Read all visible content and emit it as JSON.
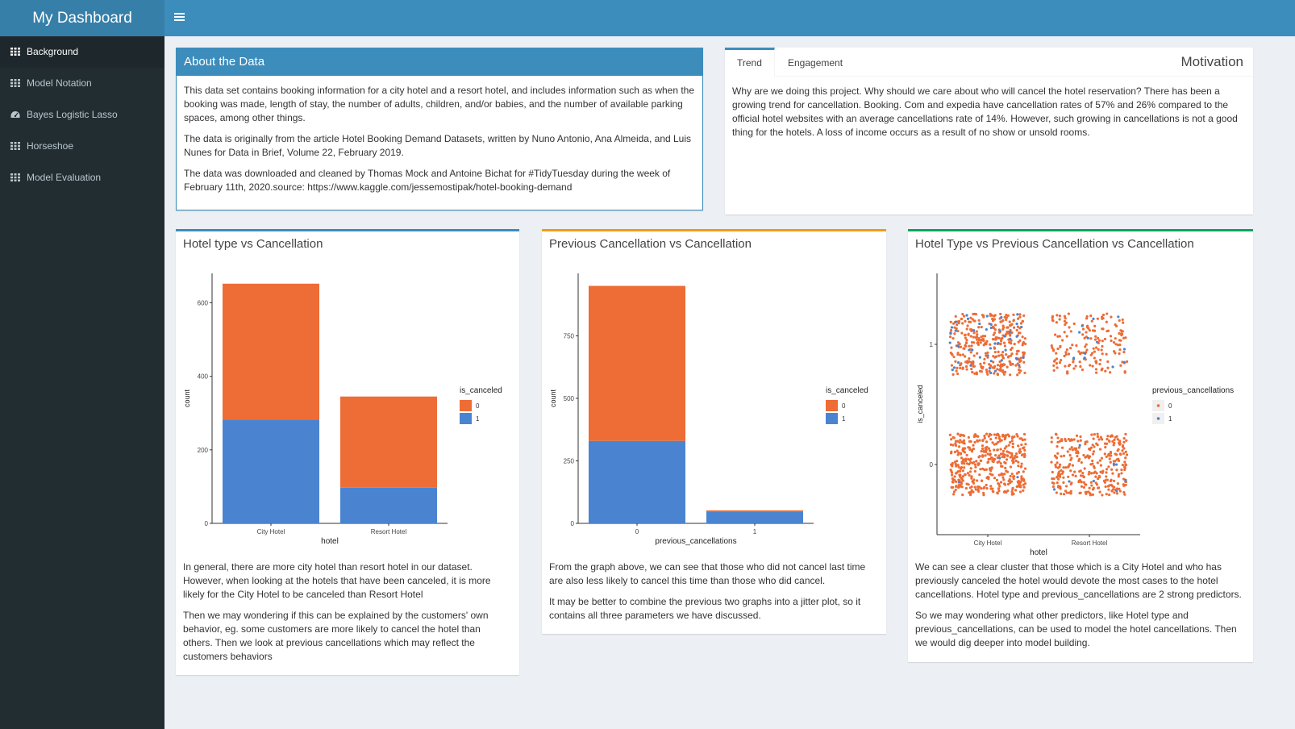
{
  "header": {
    "brand": "My Dashboard",
    "menu_icon": "hamburger-icon"
  },
  "sidebar": {
    "items": [
      {
        "label": "Background",
        "icon": "grid-icon",
        "active": true
      },
      {
        "label": "Model Notation",
        "icon": "grid-icon",
        "active": false
      },
      {
        "label": "Bayes Logistic Lasso",
        "icon": "dashboard-icon",
        "active": false
      },
      {
        "label": "Horseshoe",
        "icon": "grid-icon",
        "active": false
      },
      {
        "label": "Model Evaluation",
        "icon": "grid-icon",
        "active": false
      }
    ]
  },
  "about": {
    "title": "About the Data",
    "paragraphs": [
      "This data set contains booking information for a city hotel and a resort hotel, and includes information such as when the booking was made, length of stay, the number of adults, children, and/or babies, and the number of available parking spaces, among other things.",
      "The data is originally from the article Hotel Booking Demand Datasets, written by Nuno Antonio, Ana Almeida, and Luis Nunes for Data in Brief, Volume 22, February 2019.",
      "The data was downloaded and cleaned by Thomas Mock and Antoine Bichat for #TidyTuesday during the week of February 11th, 2020.source: https://www.kaggle.com/jessemostipak/hotel-booking-demand"
    ]
  },
  "motivation": {
    "title": "Motivation",
    "tabs": [
      "Trend",
      "Engagement"
    ],
    "text": "Why are we doing this project. Why should we care about who will cancel the hotel reservation? There has been a growing trend for cancellation. Booking. Com and expedia have cancellation rates of 57% and 26% compared to the official hotel websites with an average cancellations rate of 14%. However, such growing in cancellations is not a good thing for the hotels. A loss of income occurs as a result of no show or unsold rooms."
  },
  "colors": {
    "orange": "#ee6c35",
    "blue": "#4a84d0",
    "accent": "#3c8dbc"
  },
  "panels": [
    {
      "title": "Hotel type vs Cancellation",
      "paragraphs": [
        "In general, there are more city hotel than resort hotel in our dataset. However, when looking at the hotels that have been canceled, it is more likely for the City Hotel to be canceled than Resort Hotel",
        "Then we may wondering if this can be explained by the customers' own behavior, eg. some customers are more likely to cancel the hotel than others. Then we look at previous cancellations which may reflect the customers behaviors"
      ]
    },
    {
      "title": "Previous Cancellation vs Cancellation",
      "paragraphs": [
        "From the graph above, we can see that those who did not cancel last time are also less likely to cancel this time than those who did cancel.",
        "It may be better to combine the previous two graphs into a jitter plot, so it contains all three parameters we have discussed."
      ]
    },
    {
      "title": "Hotel Type vs Previous Cancellation vs Cancellation",
      "paragraphs": [
        "We can see a clear cluster that those which is a City Hotel and who has previously canceled the hotel would devote the most cases to the hotel cancellations. Hotel type and previous_cancellations are 2 strong predictors.",
        "So we may wondering what other predictors, like Hotel type and previous_cancellations, can be used to model the hotel cancellations. Then we would dig deeper into model building."
      ]
    }
  ],
  "chart_data": [
    {
      "type": "bar",
      "stacked": true,
      "xlabel": "hotel",
      "ylabel": "count",
      "categories": [
        "City Hotel",
        "Resort Hotel"
      ],
      "series": [
        {
          "name": "0",
          "values": [
            370,
            248
          ]
        },
        {
          "name": "1",
          "values": [
            282,
            97
          ]
        }
      ],
      "yticks": [
        0,
        200,
        400,
        600
      ],
      "ylim": [
        0,
        680
      ],
      "legend_title": "is_canceled",
      "legend_position": "right"
    },
    {
      "type": "bar",
      "stacked": true,
      "xlabel": "previous_cancellations",
      "ylabel": "count",
      "categories": [
        "0",
        "1"
      ],
      "series": [
        {
          "name": "0",
          "values": [
            620,
            5
          ]
        },
        {
          "name": "1",
          "values": [
            330,
            47
          ]
        }
      ],
      "yticks": [
        0,
        250,
        500,
        750
      ],
      "ylim": [
        0,
        1000
      ],
      "legend_title": "is_canceled",
      "legend_position": "right"
    },
    {
      "type": "scatter",
      "jitter": true,
      "xlabel": "hotel",
      "ylabel": "is_canceled",
      "categories": [
        "City Hotel",
        "Resort Hotel"
      ],
      "yticks": [
        0,
        1
      ],
      "legend_title": "previous_cancellations",
      "legend_position": "right",
      "legend_entries": [
        "0",
        "1"
      ],
      "clusters": [
        {
          "x": "City Hotel",
          "y": 1,
          "n0": 330,
          "n1": 45
        },
        {
          "x": "Resort Hotel",
          "y": 1,
          "n0": 170,
          "n1": 12
        },
        {
          "x": "City Hotel",
          "y": 0,
          "n0": 420,
          "n1": 3
        },
        {
          "x": "Resort Hotel",
          "y": 0,
          "n0": 300,
          "n1": 8
        }
      ]
    }
  ]
}
